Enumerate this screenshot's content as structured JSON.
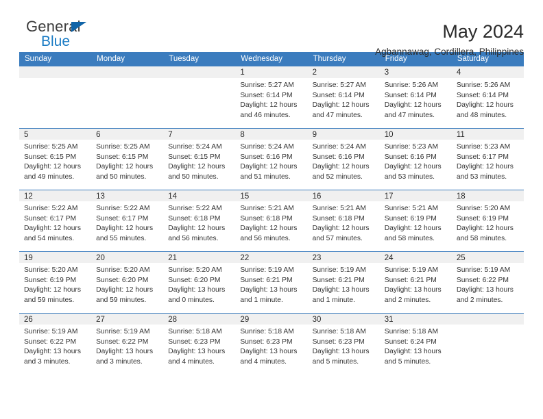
{
  "brand": {
    "word_one": "General",
    "word_two": "Blue",
    "triangle_icon": "triangle-icon",
    "color_dark": "#3c3c3c",
    "color_blue": "#1a7bc4"
  },
  "header": {
    "title": "May 2024",
    "subtitle": "Agbannawag, Cordillera, Philippines"
  },
  "theme": {
    "header_row_bg": "#3b7cbe",
    "date_band_bg": "#f0f0f0",
    "separator": "#3b7cbe",
    "text": "#333333"
  },
  "columns": [
    "Sunday",
    "Monday",
    "Tuesday",
    "Wednesday",
    "Thursday",
    "Friday",
    "Saturday"
  ],
  "labels": {
    "sunrise": "Sunrise:",
    "sunset": "Sunset:",
    "daylight": "Daylight:"
  },
  "weeks": [
    [
      {
        "day": "",
        "sunrise": "",
        "sunset": "",
        "daylight_line1": "",
        "daylight_line2": ""
      },
      {
        "day": "",
        "sunrise": "",
        "sunset": "",
        "daylight_line1": "",
        "daylight_line2": ""
      },
      {
        "day": "",
        "sunrise": "",
        "sunset": "",
        "daylight_line1": "",
        "daylight_line2": ""
      },
      {
        "day": "1",
        "sunrise": "Sunrise: 5:27 AM",
        "sunset": "Sunset: 6:14 PM",
        "daylight_line1": "Daylight: 12 hours",
        "daylight_line2": "and 46 minutes."
      },
      {
        "day": "2",
        "sunrise": "Sunrise: 5:27 AM",
        "sunset": "Sunset: 6:14 PM",
        "daylight_line1": "Daylight: 12 hours",
        "daylight_line2": "and 47 minutes."
      },
      {
        "day": "3",
        "sunrise": "Sunrise: 5:26 AM",
        "sunset": "Sunset: 6:14 PM",
        "daylight_line1": "Daylight: 12 hours",
        "daylight_line2": "and 47 minutes."
      },
      {
        "day": "4",
        "sunrise": "Sunrise: 5:26 AM",
        "sunset": "Sunset: 6:14 PM",
        "daylight_line1": "Daylight: 12 hours",
        "daylight_line2": "and 48 minutes."
      }
    ],
    [
      {
        "day": "5",
        "sunrise": "Sunrise: 5:25 AM",
        "sunset": "Sunset: 6:15 PM",
        "daylight_line1": "Daylight: 12 hours",
        "daylight_line2": "and 49 minutes."
      },
      {
        "day": "6",
        "sunrise": "Sunrise: 5:25 AM",
        "sunset": "Sunset: 6:15 PM",
        "daylight_line1": "Daylight: 12 hours",
        "daylight_line2": "and 50 minutes."
      },
      {
        "day": "7",
        "sunrise": "Sunrise: 5:24 AM",
        "sunset": "Sunset: 6:15 PM",
        "daylight_line1": "Daylight: 12 hours",
        "daylight_line2": "and 50 minutes."
      },
      {
        "day": "8",
        "sunrise": "Sunrise: 5:24 AM",
        "sunset": "Sunset: 6:16 PM",
        "daylight_line1": "Daylight: 12 hours",
        "daylight_line2": "and 51 minutes."
      },
      {
        "day": "9",
        "sunrise": "Sunrise: 5:24 AM",
        "sunset": "Sunset: 6:16 PM",
        "daylight_line1": "Daylight: 12 hours",
        "daylight_line2": "and 52 minutes."
      },
      {
        "day": "10",
        "sunrise": "Sunrise: 5:23 AM",
        "sunset": "Sunset: 6:16 PM",
        "daylight_line1": "Daylight: 12 hours",
        "daylight_line2": "and 53 minutes."
      },
      {
        "day": "11",
        "sunrise": "Sunrise: 5:23 AM",
        "sunset": "Sunset: 6:17 PM",
        "daylight_line1": "Daylight: 12 hours",
        "daylight_line2": "and 53 minutes."
      }
    ],
    [
      {
        "day": "12",
        "sunrise": "Sunrise: 5:22 AM",
        "sunset": "Sunset: 6:17 PM",
        "daylight_line1": "Daylight: 12 hours",
        "daylight_line2": "and 54 minutes."
      },
      {
        "day": "13",
        "sunrise": "Sunrise: 5:22 AM",
        "sunset": "Sunset: 6:17 PM",
        "daylight_line1": "Daylight: 12 hours",
        "daylight_line2": "and 55 minutes."
      },
      {
        "day": "14",
        "sunrise": "Sunrise: 5:22 AM",
        "sunset": "Sunset: 6:18 PM",
        "daylight_line1": "Daylight: 12 hours",
        "daylight_line2": "and 56 minutes."
      },
      {
        "day": "15",
        "sunrise": "Sunrise: 5:21 AM",
        "sunset": "Sunset: 6:18 PM",
        "daylight_line1": "Daylight: 12 hours",
        "daylight_line2": "and 56 minutes."
      },
      {
        "day": "16",
        "sunrise": "Sunrise: 5:21 AM",
        "sunset": "Sunset: 6:18 PM",
        "daylight_line1": "Daylight: 12 hours",
        "daylight_line2": "and 57 minutes."
      },
      {
        "day": "17",
        "sunrise": "Sunrise: 5:21 AM",
        "sunset": "Sunset: 6:19 PM",
        "daylight_line1": "Daylight: 12 hours",
        "daylight_line2": "and 58 minutes."
      },
      {
        "day": "18",
        "sunrise": "Sunrise: 5:20 AM",
        "sunset": "Sunset: 6:19 PM",
        "daylight_line1": "Daylight: 12 hours",
        "daylight_line2": "and 58 minutes."
      }
    ],
    [
      {
        "day": "19",
        "sunrise": "Sunrise: 5:20 AM",
        "sunset": "Sunset: 6:19 PM",
        "daylight_line1": "Daylight: 12 hours",
        "daylight_line2": "and 59 minutes."
      },
      {
        "day": "20",
        "sunrise": "Sunrise: 5:20 AM",
        "sunset": "Sunset: 6:20 PM",
        "daylight_line1": "Daylight: 12 hours",
        "daylight_line2": "and 59 minutes."
      },
      {
        "day": "21",
        "sunrise": "Sunrise: 5:20 AM",
        "sunset": "Sunset: 6:20 PM",
        "daylight_line1": "Daylight: 13 hours",
        "daylight_line2": "and 0 minutes."
      },
      {
        "day": "22",
        "sunrise": "Sunrise: 5:19 AM",
        "sunset": "Sunset: 6:21 PM",
        "daylight_line1": "Daylight: 13 hours",
        "daylight_line2": "and 1 minute."
      },
      {
        "day": "23",
        "sunrise": "Sunrise: 5:19 AM",
        "sunset": "Sunset: 6:21 PM",
        "daylight_line1": "Daylight: 13 hours",
        "daylight_line2": "and 1 minute."
      },
      {
        "day": "24",
        "sunrise": "Sunrise: 5:19 AM",
        "sunset": "Sunset: 6:21 PM",
        "daylight_line1": "Daylight: 13 hours",
        "daylight_line2": "and 2 minutes."
      },
      {
        "day": "25",
        "sunrise": "Sunrise: 5:19 AM",
        "sunset": "Sunset: 6:22 PM",
        "daylight_line1": "Daylight: 13 hours",
        "daylight_line2": "and 2 minutes."
      }
    ],
    [
      {
        "day": "26",
        "sunrise": "Sunrise: 5:19 AM",
        "sunset": "Sunset: 6:22 PM",
        "daylight_line1": "Daylight: 13 hours",
        "daylight_line2": "and 3 minutes."
      },
      {
        "day": "27",
        "sunrise": "Sunrise: 5:19 AM",
        "sunset": "Sunset: 6:22 PM",
        "daylight_line1": "Daylight: 13 hours",
        "daylight_line2": "and 3 minutes."
      },
      {
        "day": "28",
        "sunrise": "Sunrise: 5:18 AM",
        "sunset": "Sunset: 6:23 PM",
        "daylight_line1": "Daylight: 13 hours",
        "daylight_line2": "and 4 minutes."
      },
      {
        "day": "29",
        "sunrise": "Sunrise: 5:18 AM",
        "sunset": "Sunset: 6:23 PM",
        "daylight_line1": "Daylight: 13 hours",
        "daylight_line2": "and 4 minutes."
      },
      {
        "day": "30",
        "sunrise": "Sunrise: 5:18 AM",
        "sunset": "Sunset: 6:23 PM",
        "daylight_line1": "Daylight: 13 hours",
        "daylight_line2": "and 5 minutes."
      },
      {
        "day": "31",
        "sunrise": "Sunrise: 5:18 AM",
        "sunset": "Sunset: 6:24 PM",
        "daylight_line1": "Daylight: 13 hours",
        "daylight_line2": "and 5 minutes."
      },
      {
        "day": "",
        "sunrise": "",
        "sunset": "",
        "daylight_line1": "",
        "daylight_line2": ""
      }
    ]
  ]
}
